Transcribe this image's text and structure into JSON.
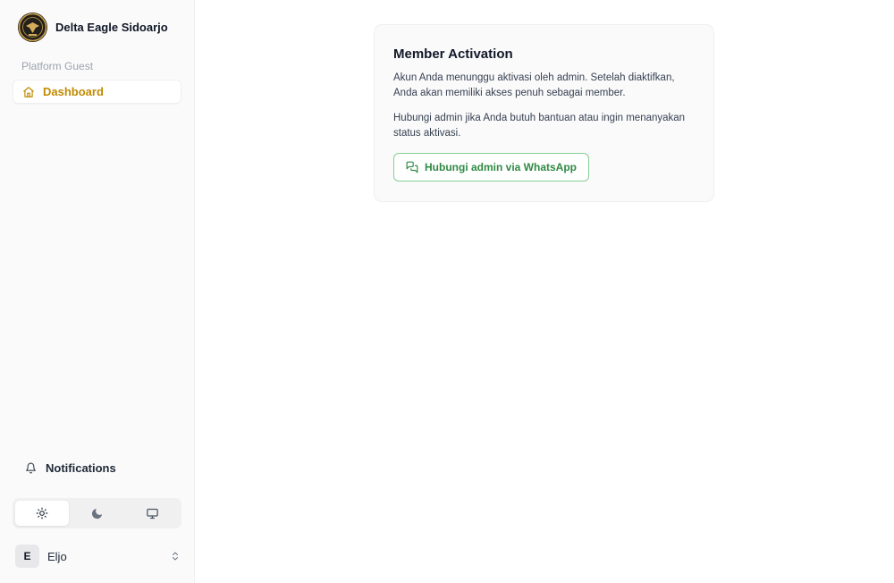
{
  "sidebar": {
    "brand": {
      "name": "Delta Eagle Sidoarjo",
      "logo_icon": "eagle-emblem-icon"
    },
    "group_label": "Platform Guest",
    "nav_items": [
      {
        "label": "Dashboard",
        "icon": "home-icon",
        "active": true
      }
    ],
    "notifications": {
      "label": "Notifications",
      "icon": "bell-icon"
    },
    "theme_switch": {
      "options": [
        {
          "icon": "sun-icon",
          "active": true
        },
        {
          "icon": "moon-icon",
          "active": false
        },
        {
          "icon": "monitor-icon",
          "active": false
        }
      ]
    },
    "user": {
      "initial": "E",
      "name": "Eljo",
      "icon": "chevron-up-down-icon"
    }
  },
  "card": {
    "title": "Member Activation",
    "paragraph_1": "Akun Anda menunggu aktivasi oleh admin. Setelah diaktifkan, Anda akan memiliki akses penuh sebagai member.",
    "paragraph_2": "Hubungi admin jika Anda butuh bantuan atau ingin menanyakan status aktivasi.",
    "button": {
      "label": "Hubungi admin via WhatsApp",
      "icon": "chat-icon"
    }
  },
  "colors": {
    "accent": "#c28a00",
    "whatsapp_green": "#2f8a43",
    "whatsapp_border": "#86cf94"
  }
}
